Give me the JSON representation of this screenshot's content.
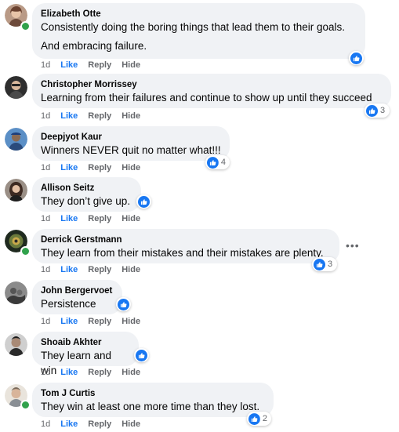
{
  "comments": [
    {
      "author": "Elizabeth Otte",
      "text": "Consistently doing the boring things that lead them to their goals.",
      "text2": "And embracing failure.",
      "time": "1d",
      "like": "Like",
      "reply": "Reply",
      "hide": "Hide",
      "reactions": ""
    },
    {
      "author": "Christopher Morrissey",
      "text": "Learning from their failures and continue to show up until they succeed",
      "time": "1d",
      "like": "Like",
      "reply": "Reply",
      "hide": "Hide",
      "reactions": "3"
    },
    {
      "author": "Deepjyot Kaur",
      "text": "Winners NEVER quit no matter what!!!",
      "time": "1d",
      "like": "Like",
      "reply": "Reply",
      "hide": "Hide",
      "reactions": "4"
    },
    {
      "author": "Allison Seitz",
      "text": "They don’t give up.",
      "time": "1d",
      "like": "Like",
      "reply": "Reply",
      "hide": "Hide",
      "reactions": ""
    },
    {
      "author": "Derrick Gerstmann",
      "text": "They learn from their mistakes and their mistakes are plenty.",
      "time": "1d",
      "like": "Like",
      "reply": "Reply",
      "hide": "Hide",
      "reactions": "3"
    },
    {
      "author": "John Bergervoet",
      "text": "Persistence",
      "time": "1d",
      "like": "Like",
      "reply": "Reply",
      "hide": "Hide",
      "reactions": ""
    },
    {
      "author": "Shoaib Akhter",
      "text": "They learn and win",
      "time": "1d",
      "like": "Like",
      "reply": "Reply",
      "hide": "Hide",
      "reactions": ""
    },
    {
      "author": "Tom J Curtis",
      "text": "They win at least one more time than they lost.",
      "time": "1d",
      "like": "Like",
      "reply": "Reply",
      "hide": "Hide",
      "reactions": "2"
    }
  ],
  "more_options_label": "•••",
  "colors": {
    "like_blue": "#1877f2",
    "bubble_bg": "#f0f2f5",
    "meta_gray": "#65676b",
    "online_green": "#31a24c"
  }
}
